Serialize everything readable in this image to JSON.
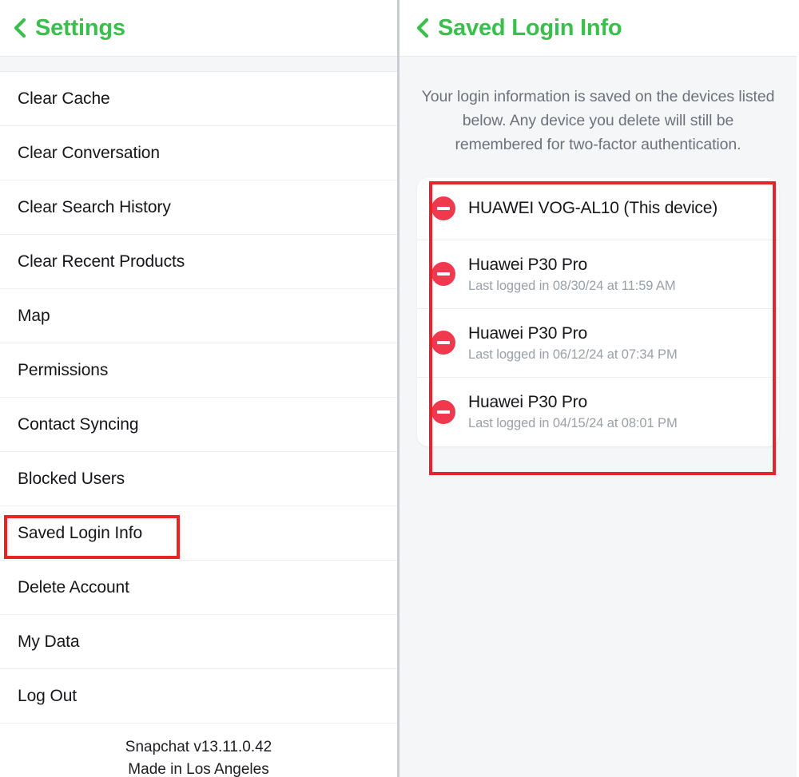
{
  "left_pane": {
    "header": {
      "back_icon": "chevron-left-icon",
      "title": "Settings"
    },
    "menu_items": [
      {
        "label": "Clear Cache"
      },
      {
        "label": "Clear Conversation"
      },
      {
        "label": "Clear Search History"
      },
      {
        "label": "Clear Recent Products"
      },
      {
        "label": "Map"
      },
      {
        "label": "Permissions"
      },
      {
        "label": "Contact Syncing"
      },
      {
        "label": "Blocked Users"
      },
      {
        "label": "Saved Login Info"
      },
      {
        "label": "Delete Account"
      },
      {
        "label": "My Data"
      },
      {
        "label": "Log Out"
      }
    ],
    "highlighted_item": "Saved Login Info",
    "footer": {
      "version": "Snapchat v13.11.0.42",
      "made_in": "Made in Los Angeles"
    }
  },
  "right_pane": {
    "header": {
      "back_icon": "chevron-left-icon",
      "title": "Saved Login Info"
    },
    "description": "Your login information is saved on the devices listed below. Any device you delete will still be remembered for two-factor authentication.",
    "devices": [
      {
        "name": "HUAWEI VOG-AL10 (This device)",
        "last_login": "",
        "remove_icon": "remove-circle-icon"
      },
      {
        "name": "Huawei P30 Pro",
        "last_login": "Last logged in 08/30/24 at 11:59 AM",
        "remove_icon": "remove-circle-icon"
      },
      {
        "name": "Huawei P30 Pro",
        "last_login": "Last logged in 06/12/24 at 07:34 PM",
        "remove_icon": "remove-circle-icon"
      },
      {
        "name": "Huawei P30 Pro",
        "last_login": "Last logged in 04/15/24 at 08:01 PM",
        "remove_icon": "remove-circle-icon"
      }
    ]
  },
  "colors": {
    "accent_green": "#3ABF4D",
    "highlight_red": "#E8242A",
    "remove_red": "#F0394F",
    "panel_background": "#F5F6F8",
    "primary_text": "#14161A",
    "secondary_text": "#9AA0A8",
    "description_text": "#6C717B"
  }
}
